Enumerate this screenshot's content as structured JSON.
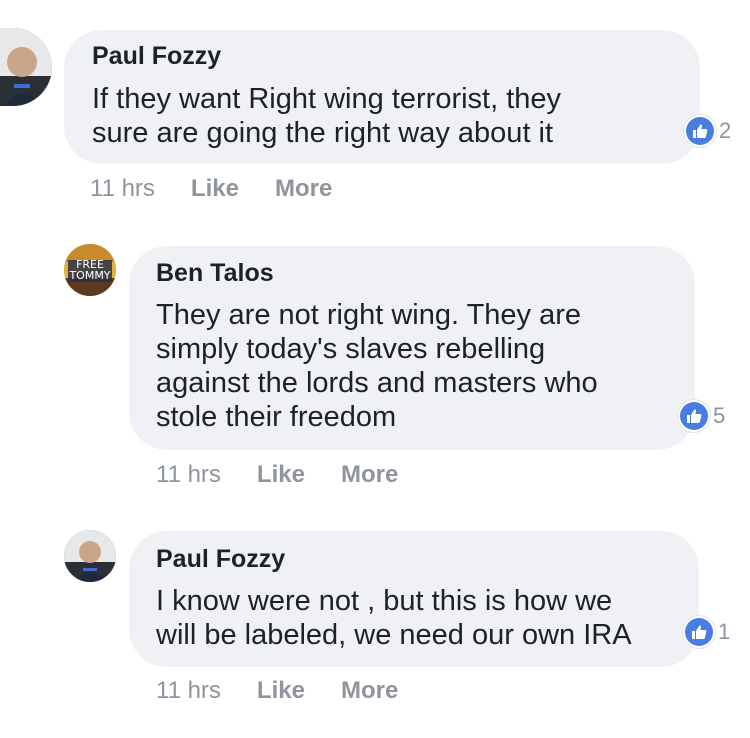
{
  "comments": [
    {
      "author": "Paul Fozzy",
      "lines": [
        "If they want Right wing terrorist, they",
        "sure are going the right way about it"
      ],
      "reactions": "2",
      "time": "11 hrs",
      "like_label": "Like",
      "more_label": "More"
    },
    {
      "author": "Ben Talos",
      "avatar_text": [
        "FREE",
        "TOMMY"
      ],
      "lines": [
        "They are not right wing. They are",
        "simply today's slaves rebelling",
        "against the lords and masters who",
        "stole their freedom"
      ],
      "reactions": "5",
      "time": "11 hrs",
      "like_label": "Like",
      "more_label": "More"
    },
    {
      "author": "Paul Fozzy",
      "lines": [
        "I know were not , but this is how we",
        "will be labeled, we need our own IRA"
      ],
      "reactions": "1",
      "time": "11 hrs",
      "like_label": "Like",
      "more_label": "More"
    }
  ],
  "icons": {
    "reaction": "thumbs-up-icon",
    "reaction_color": "#4a7de2"
  }
}
